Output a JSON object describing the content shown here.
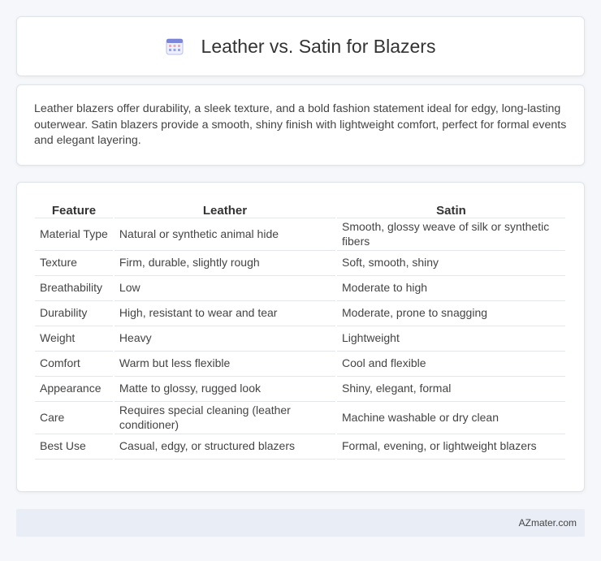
{
  "header": {
    "title": "Leather vs. Satin for Blazers",
    "icon": "calendar-icon"
  },
  "intro": {
    "text": "Leather blazers offer durability, a sleek texture, and a bold fashion statement ideal for edgy, long-lasting outerwear. Satin blazers provide a smooth, shiny finish with lightweight comfort, perfect for formal events and elegant layering."
  },
  "table": {
    "headers": [
      "Feature",
      "Leather",
      "Satin"
    ],
    "rows": [
      [
        "Material Type",
        "Natural or synthetic animal hide",
        "Smooth, glossy weave of silk or synthetic fibers"
      ],
      [
        "Texture",
        "Firm, durable, slightly rough",
        "Soft, smooth, shiny"
      ],
      [
        "Breathability",
        "Low",
        "Moderate to high"
      ],
      [
        "Durability",
        "High, resistant to wear and tear",
        "Moderate, prone to snagging"
      ],
      [
        "Weight",
        "Heavy",
        "Lightweight"
      ],
      [
        "Comfort",
        "Warm but less flexible",
        "Cool and flexible"
      ],
      [
        "Appearance",
        "Matte to glossy, rugged look",
        "Shiny, elegant, formal"
      ],
      [
        "Care",
        "Requires special cleaning (leather conditioner)",
        "Machine washable or dry clean"
      ],
      [
        "Best Use",
        "Casual, edgy, or structured blazers",
        "Formal, evening, or lightweight blazers"
      ]
    ]
  },
  "footer": {
    "text": "AZmater.com"
  }
}
